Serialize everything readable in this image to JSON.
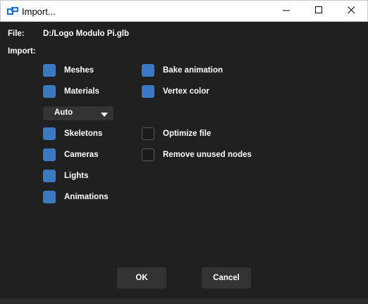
{
  "window": {
    "title": "Import...",
    "icon": "app-import-icon",
    "controls": [
      "minimize-icon",
      "maximize-icon",
      "close-icon"
    ]
  },
  "file": {
    "label": "File:",
    "value": "D:/Logo Modulo Pi.glb"
  },
  "import_label": "Import:",
  "options": {
    "meshes": {
      "label": "Meshes",
      "checked": true
    },
    "materials": {
      "label": "Materials",
      "checked": true
    },
    "skeletons": {
      "label": "Skeletons",
      "checked": true
    },
    "cameras": {
      "label": "Cameras",
      "checked": true
    },
    "lights": {
      "label": "Lights",
      "checked": true
    },
    "animations": {
      "label": "Animations",
      "checked": true
    },
    "bake_animation": {
      "label": "Bake animation",
      "checked": true
    },
    "vertex_color": {
      "label": "Vertex color",
      "checked": true
    },
    "optimize_file": {
      "label": "Optimize file",
      "checked": false
    },
    "remove_unused_nodes": {
      "label": "Remove unused nodes",
      "checked": false
    }
  },
  "materials_mode": {
    "value": "Auto"
  },
  "buttons": {
    "ok": "OK",
    "cancel": "Cancel"
  },
  "colors": {
    "checked": "#3c79c3",
    "background": "#202020",
    "control": "#333333"
  }
}
